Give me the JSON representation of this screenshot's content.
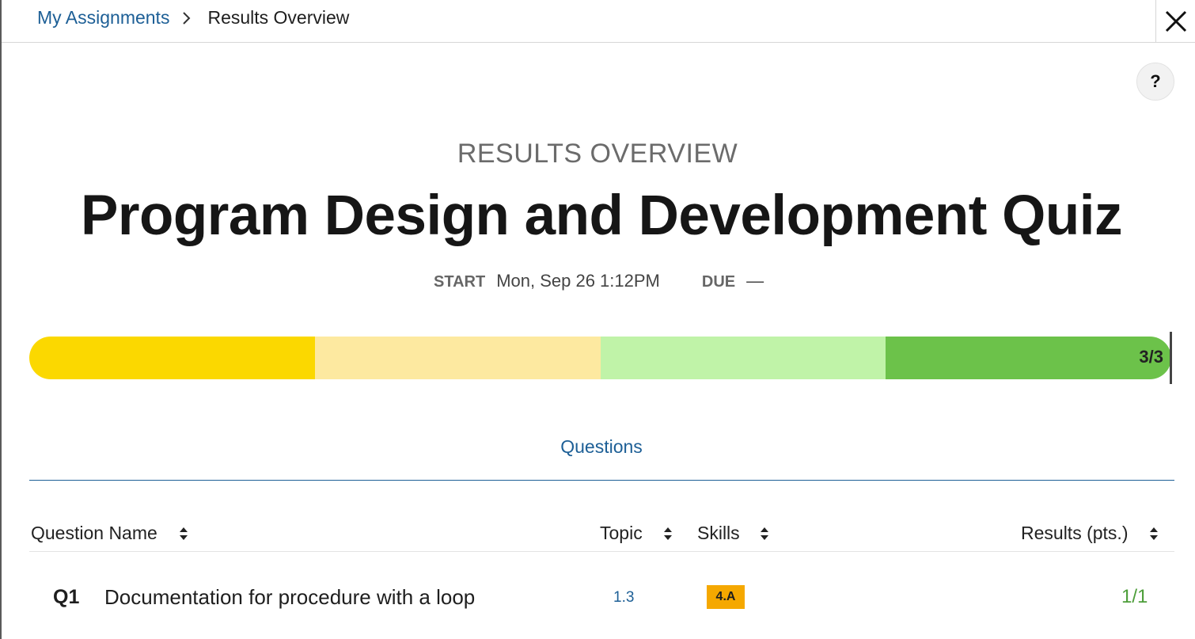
{
  "breadcrumb": {
    "parent": "My Assignments",
    "current": "Results Overview"
  },
  "help_label": "?",
  "header": {
    "eyebrow": "RESULTS OVERVIEW",
    "title": "Program Design and Development Quiz"
  },
  "dates": {
    "start_label": "START",
    "start_value": "Mon, Sep 26 1:12PM",
    "due_label": "DUE",
    "due_value": "—"
  },
  "progress": {
    "label": "3/3",
    "score": 3,
    "max": 3,
    "segment_colors": [
      "#fbd800",
      "#fde9a0",
      "#c0f3a8",
      "#6cc24a"
    ]
  },
  "tabs": {
    "questions": "Questions"
  },
  "table": {
    "columns": {
      "name": "Question Name",
      "topic": "Topic",
      "skills": "Skills",
      "results": "Results (pts.)"
    },
    "rows": [
      {
        "number": "Q1",
        "name": "Documentation for procedure with a loop",
        "topic": "1.3",
        "skill": "4.A",
        "result": "1/1"
      }
    ]
  },
  "colors": {
    "link": "#1d5f96",
    "skill_badge": "#f5a800",
    "result_text": "#4d9e3a"
  }
}
